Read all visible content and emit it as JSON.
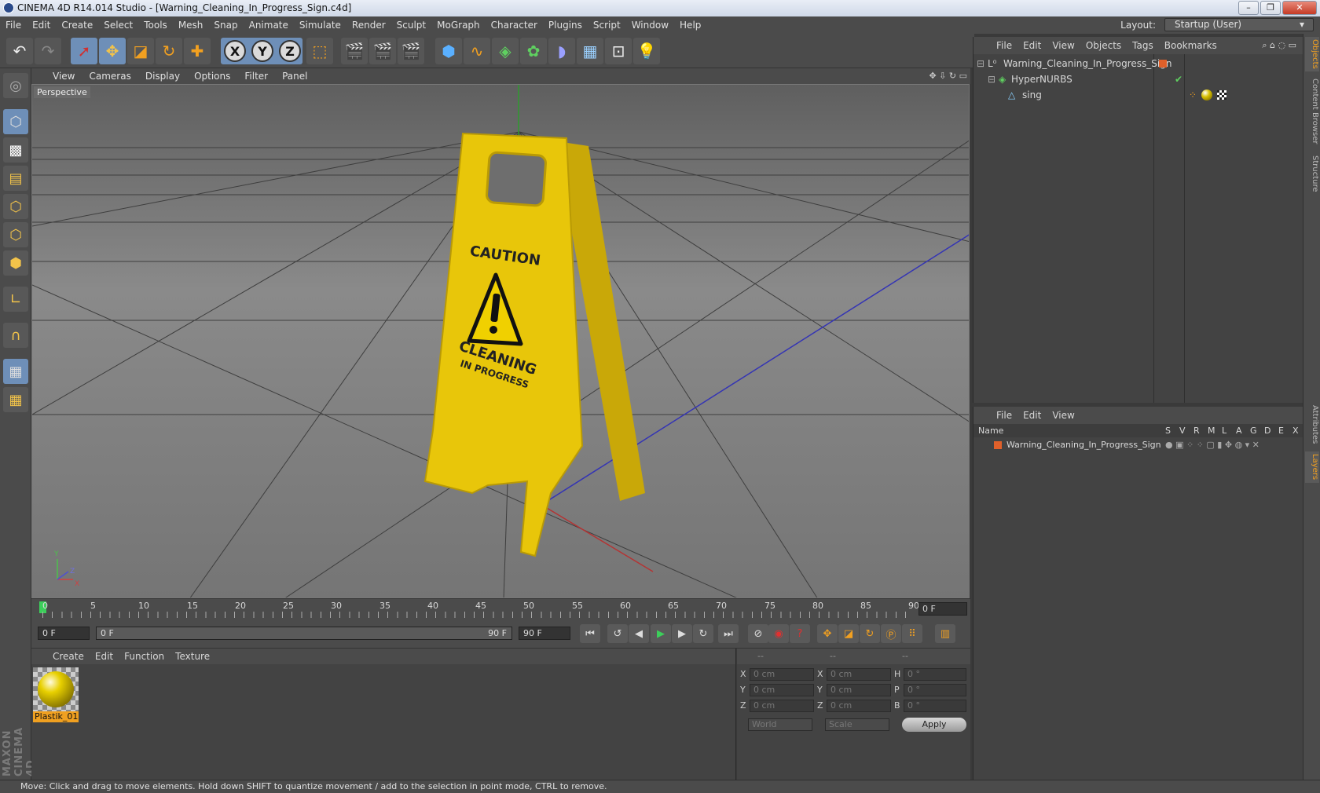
{
  "window": {
    "title": "CINEMA 4D R14.014 Studio - [Warning_Cleaning_In_Progress_Sign.c4d]",
    "minimize": "–",
    "maximize": "❐",
    "close": "✕"
  },
  "menubar": {
    "items": [
      "File",
      "Edit",
      "Create",
      "Select",
      "Tools",
      "Mesh",
      "Snap",
      "Animate",
      "Simulate",
      "Render",
      "Sculpt",
      "MoGraph",
      "Character",
      "Plugins",
      "Script",
      "Window",
      "Help"
    ],
    "layout_label": "Layout:",
    "layout_value": "Startup (User)"
  },
  "viewport": {
    "menu": [
      "View",
      "Cameras",
      "Display",
      "Options",
      "Filter",
      "Panel"
    ],
    "label": "Perspective",
    "sign_text_top": "CAUTION",
    "sign_text_mid": "CLEANING",
    "sign_text_bottom": "IN PROGRESS",
    "axis_y": "Y",
    "axis_z": "Z",
    "axis_x": "X"
  },
  "timeline": {
    "ticks": [
      "0",
      "5",
      "10",
      "15",
      "20",
      "25",
      "30",
      "35",
      "40",
      "45",
      "50",
      "55",
      "60",
      "65",
      "70",
      "75",
      "80",
      "85",
      "90"
    ],
    "current_frame": "0 F"
  },
  "transport": {
    "start_field": "0 F",
    "range_start": "0 F",
    "range_end": "90 F",
    "end_field": "90 F"
  },
  "materials": {
    "menu": [
      "Create",
      "Edit",
      "Function",
      "Texture"
    ],
    "items": [
      {
        "name": "Plastik_01"
      }
    ]
  },
  "coordinates": {
    "headers": [
      "--",
      "--",
      "--"
    ],
    "rows": [
      {
        "a": "X",
        "av": "0 cm",
        "b": "X",
        "bv": "0 cm",
        "c": "H",
        "cv": "0 °"
      },
      {
        "a": "Y",
        "av": "0 cm",
        "b": "Y",
        "bv": "0 cm",
        "c": "P",
        "cv": "0 °"
      },
      {
        "a": "Z",
        "av": "0 cm",
        "b": "Z",
        "bv": "0 cm",
        "c": "B",
        "cv": "0 °"
      }
    ],
    "space": "World",
    "mode": "Scale",
    "apply": "Apply"
  },
  "objects": {
    "menu": [
      "File",
      "Edit",
      "View",
      "Objects",
      "Tags",
      "Bookmarks"
    ],
    "tree": [
      {
        "name": "Warning_Cleaning_In_Progress_Sign",
        "indent": 0
      },
      {
        "name": "HyperNURBS",
        "indent": 1
      },
      {
        "name": "sing",
        "indent": 2
      }
    ]
  },
  "layers": {
    "menu": [
      "File",
      "Edit",
      "View"
    ],
    "header_name": "Name",
    "header_cols": [
      "S",
      "V",
      "R",
      "M",
      "L",
      "A",
      "G",
      "D",
      "E",
      "X"
    ],
    "rows": [
      {
        "name": "Warning_Cleaning_In_Progress_Sign"
      }
    ]
  },
  "sidetabs": [
    "Objects",
    "Content Browser",
    "Structure",
    "Attributes",
    "Layers"
  ],
  "status": "Move: Click and drag to move elements. Hold down SHIFT to quantize movement / add to the selection in point mode, CTRL to remove.",
  "brand": "MAXON CINEMA 4D",
  "colors": {
    "accent": "#6e8fb8",
    "layer_orange": "#e0602a",
    "sign_yellow": "#e8c60a"
  }
}
